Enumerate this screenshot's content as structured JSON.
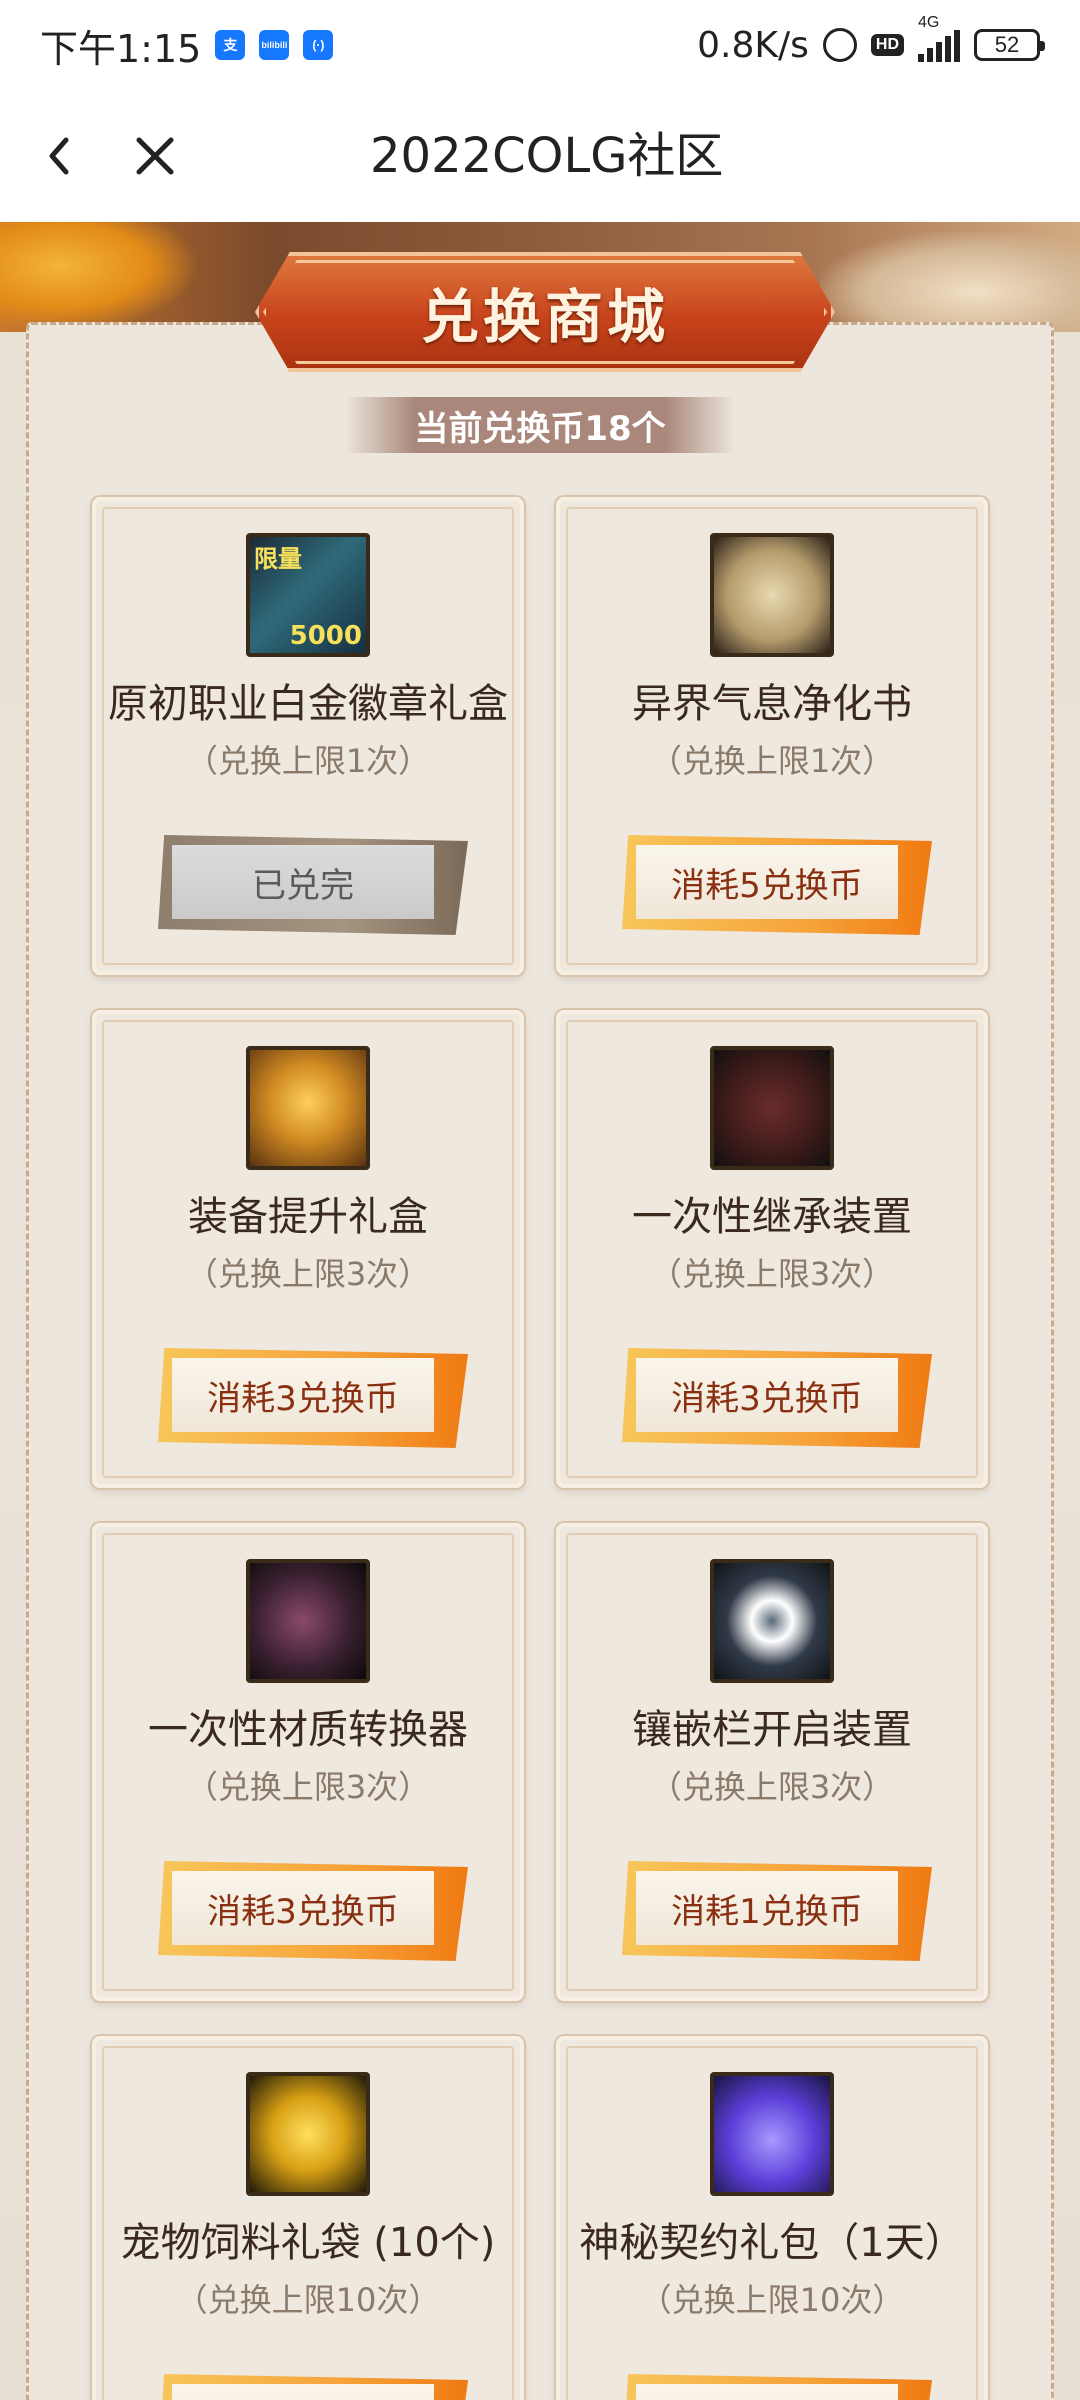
{
  "status_bar": {
    "time": "下午1:15",
    "app_icons": [
      "支",
      "bilibili",
      "(·)"
    ],
    "net_speed": "0.8K/s",
    "hd": "HD",
    "network": "4G",
    "battery": "52"
  },
  "nav": {
    "title": "2022COLG社区",
    "back_icon": "chevron-left-icon",
    "close_icon": "close-icon"
  },
  "page": {
    "title": "兑换商城",
    "coin_text": "当前兑换币18个"
  },
  "items": [
    {
      "name": "原初职业白金徽章礼盒",
      "limit": "（兑换上限1次）",
      "button": "已兑完",
      "done": true,
      "icon": "badge-box-icon",
      "badge_top": "限量",
      "badge_bottom": "5000"
    },
    {
      "name": "异界气息净化书",
      "limit": "（兑换上限1次）",
      "button": "消耗5兑换币",
      "done": false,
      "icon": "scroll-icon"
    },
    {
      "name": "装备提升礼盒",
      "limit": "（兑换上限3次）",
      "button": "消耗3兑换币",
      "done": false,
      "icon": "treasure-chest-icon"
    },
    {
      "name": "一次性继承装置",
      "limit": "（兑换上限3次）",
      "button": "消耗3兑换币",
      "done": false,
      "icon": "inherit-device-icon"
    },
    {
      "name": "一次性材质转换器",
      "limit": "（兑换上限3次）",
      "button": "消耗3兑换币",
      "done": false,
      "icon": "material-converter-icon"
    },
    {
      "name": "镶嵌栏开启装置",
      "limit": "（兑换上限3次）",
      "button": "消耗1兑换币",
      "done": false,
      "icon": "socket-opener-icon"
    },
    {
      "name": "宠物饲料礼袋 (10个)",
      "limit": "（兑换上限10次）",
      "button": "",
      "done": false,
      "icon": "pet-feed-icon"
    },
    {
      "name": "神秘契约礼包（1天）",
      "limit": "（兑换上限10次）",
      "button": "",
      "done": false,
      "icon": "mystery-bag-icon"
    }
  ]
}
